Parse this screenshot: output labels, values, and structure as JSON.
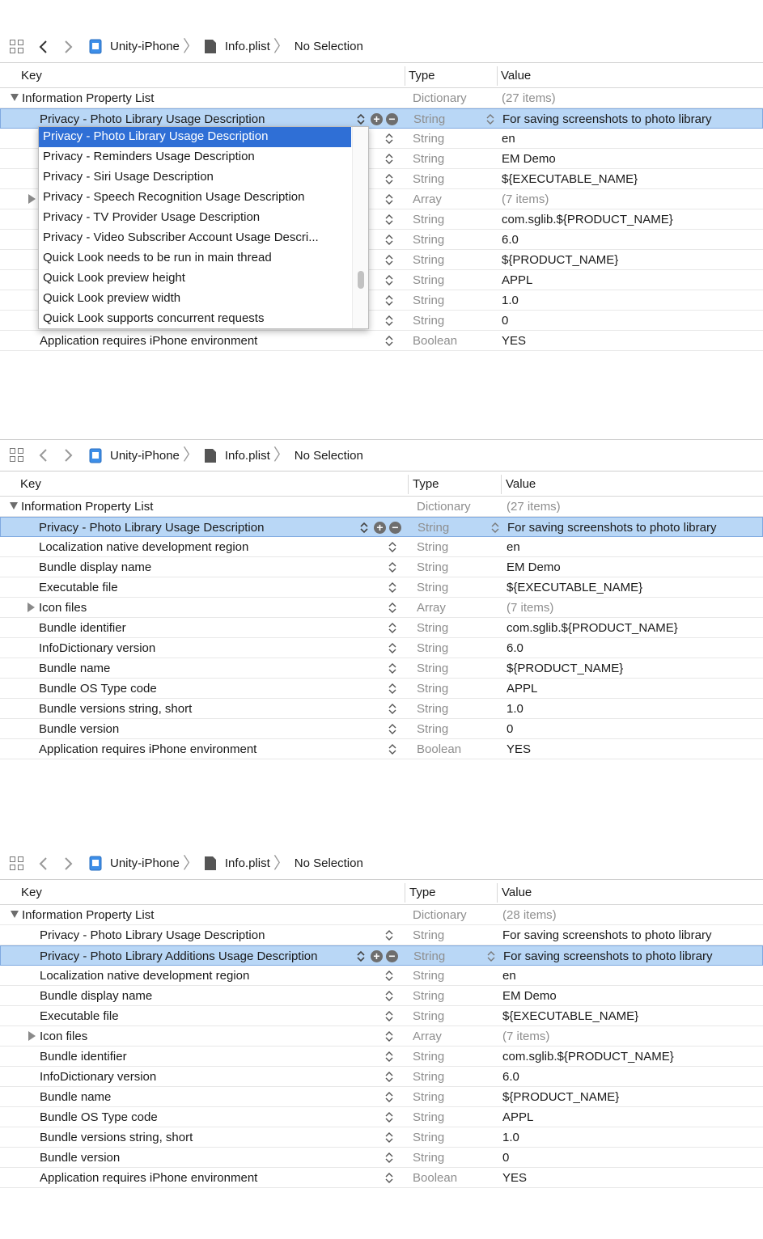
{
  "panels": [
    {
      "breadcrumb": {
        "project": "Unity-iPhone",
        "file": "Info.plist",
        "selection": "No Selection"
      },
      "columns": {
        "key": "Key",
        "type": "Type",
        "value": "Value"
      },
      "root": {
        "key": "Information Property List",
        "type": "Dictionary",
        "value": "(27 items)"
      },
      "rows": [
        {
          "key": "Privacy - Photo Library Usage Description",
          "type": "String",
          "value": "For saving screenshots to photo library",
          "selected": true
        },
        {
          "key": "",
          "type": "String",
          "value": "en"
        },
        {
          "key": "",
          "type": "String",
          "value": "EM Demo"
        },
        {
          "key": "",
          "type": "String",
          "value": "${EXECUTABLE_NAME}"
        },
        {
          "key": "",
          "type": "Array",
          "value": "(7 items)",
          "expandable": true
        },
        {
          "key": "",
          "type": "String",
          "value": "com.sglib.${PRODUCT_NAME}"
        },
        {
          "key": "",
          "type": "String",
          "value": "6.0"
        },
        {
          "key": "",
          "type": "String",
          "value": "${PRODUCT_NAME}"
        },
        {
          "key": "",
          "type": "String",
          "value": "APPL"
        },
        {
          "key": "",
          "type": "String",
          "value": "1.0"
        },
        {
          "key": "",
          "type": "String",
          "value": "0"
        },
        {
          "key": "Application requires iPhone environment",
          "type": "Boolean",
          "value": "YES"
        }
      ],
      "dropdown": {
        "items": [
          "Privacy - Photo Library Usage Description",
          "Privacy - Reminders Usage Description",
          "Privacy - Siri Usage Description",
          "Privacy - Speech Recognition Usage Description",
          "Privacy - TV Provider Usage Description",
          "Privacy - Video Subscriber Account Usage Descri...",
          "Quick Look needs to be run in main thread",
          "Quick Look preview height",
          "Quick Look preview width",
          "Quick Look supports concurrent requests"
        ],
        "highlighted_index": 0
      }
    },
    {
      "breadcrumb": {
        "project": "Unity-iPhone",
        "file": "Info.plist",
        "selection": "No Selection"
      },
      "columns": {
        "key": "Key",
        "type": "Type",
        "value": "Value"
      },
      "root": {
        "key": "Information Property List",
        "type": "Dictionary",
        "value": "(27 items)"
      },
      "rows": [
        {
          "key": "Privacy - Photo Library Usage Description",
          "type": "String",
          "value": "For saving screenshots to photo library",
          "selected": true
        },
        {
          "key": "Localization native development region",
          "type": "String",
          "value": "en"
        },
        {
          "key": "Bundle display name",
          "type": "String",
          "value": "EM Demo"
        },
        {
          "key": "Executable file",
          "type": "String",
          "value": "${EXECUTABLE_NAME}"
        },
        {
          "key": "Icon files",
          "type": "Array",
          "value": "(7 items)",
          "expandable": true
        },
        {
          "key": "Bundle identifier",
          "type": "String",
          "value": "com.sglib.${PRODUCT_NAME}"
        },
        {
          "key": "InfoDictionary version",
          "type": "String",
          "value": "6.0"
        },
        {
          "key": "Bundle name",
          "type": "String",
          "value": "${PRODUCT_NAME}"
        },
        {
          "key": "Bundle OS Type code",
          "type": "String",
          "value": "APPL"
        },
        {
          "key": "Bundle versions string, short",
          "type": "String",
          "value": "1.0"
        },
        {
          "key": "Bundle version",
          "type": "String",
          "value": "0"
        },
        {
          "key": "Application requires iPhone environment",
          "type": "Boolean",
          "value": "YES"
        }
      ]
    },
    {
      "breadcrumb": {
        "project": "Unity-iPhone",
        "file": "Info.plist",
        "selection": "No Selection"
      },
      "columns": {
        "key": "Key",
        "type": "Type",
        "value": "Value"
      },
      "root": {
        "key": "Information Property List",
        "type": "Dictionary",
        "value": "(28 items)"
      },
      "rows": [
        {
          "key": "Privacy - Photo Library Usage Description",
          "type": "String",
          "value": "For saving screenshots to photo library"
        },
        {
          "key": "Privacy - Photo Library Additions Usage Description",
          "type": "String",
          "value": "For saving screenshots to photo library",
          "selected": true
        },
        {
          "key": "Localization native development region",
          "type": "String",
          "value": "en"
        },
        {
          "key": "Bundle display name",
          "type": "String",
          "value": "EM Demo"
        },
        {
          "key": "Executable file",
          "type": "String",
          "value": "${EXECUTABLE_NAME}"
        },
        {
          "key": "Icon files",
          "type": "Array",
          "value": "(7 items)",
          "expandable": true
        },
        {
          "key": "Bundle identifier",
          "type": "String",
          "value": "com.sglib.${PRODUCT_NAME}"
        },
        {
          "key": "InfoDictionary version",
          "type": "String",
          "value": "6.0"
        },
        {
          "key": "Bundle name",
          "type": "String",
          "value": "${PRODUCT_NAME}"
        },
        {
          "key": "Bundle OS Type code",
          "type": "String",
          "value": "APPL"
        },
        {
          "key": "Bundle versions string, short",
          "type": "String",
          "value": "1.0"
        },
        {
          "key": "Bundle version",
          "type": "String",
          "value": "0"
        },
        {
          "key": "Application requires iPhone environment",
          "type": "Boolean",
          "value": "YES"
        }
      ]
    }
  ],
  "icons": {
    "grid": "related-items-grid-icon",
    "back": "back-arrow-icon",
    "forward": "forward-arrow-icon",
    "project": "xcode-project-icon",
    "file": "plist-file-icon",
    "stepper": "up-down-stepper-icon",
    "add": "add-circle-icon",
    "remove": "remove-circle-icon"
  },
  "colors": {
    "selection": "#b9d7f6",
    "menu_highlight": "#2f6fd6",
    "muted_text": "#8e8e8e"
  }
}
